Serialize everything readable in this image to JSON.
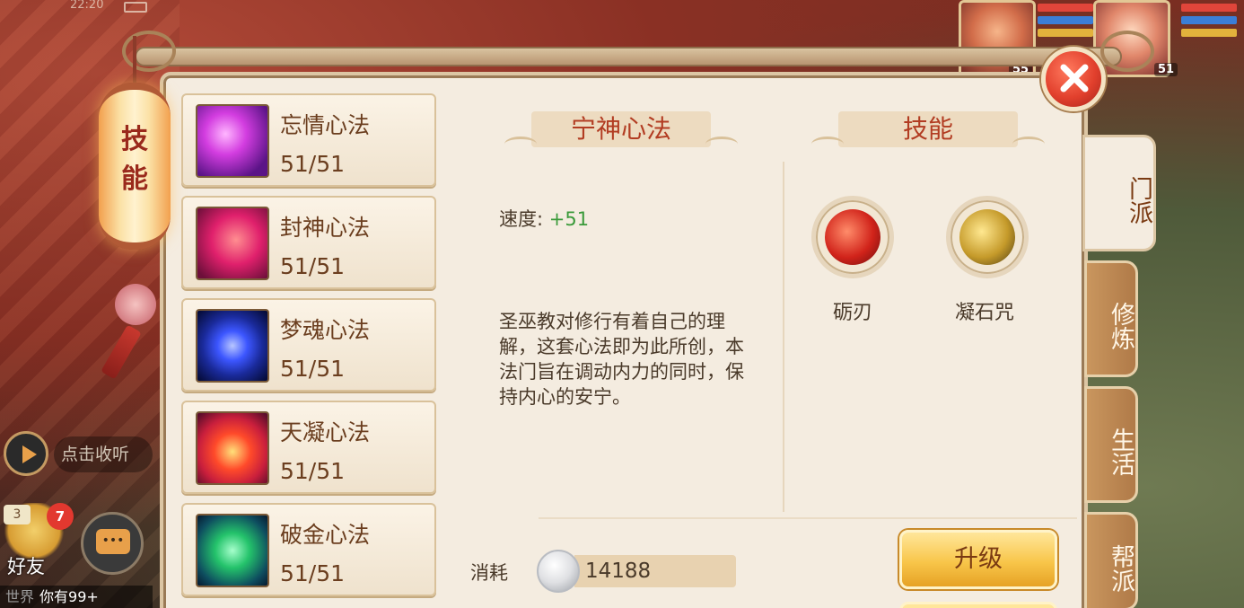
{
  "status": {
    "time": "22:20"
  },
  "party": [
    {
      "level": "55"
    },
    {
      "level": "51"
    }
  ],
  "chat": {
    "play_hint": "点击收听",
    "friend_label": "好友",
    "friend_badge": "7",
    "friend_count": "3",
    "channel": "世界",
    "message": "你有99+"
  },
  "panel": {
    "lantern_label": "技能",
    "skills": [
      {
        "name": "忘情心法",
        "level": "51/51",
        "icon": "pink-swirl-icon"
      },
      {
        "name": "封神心法",
        "level": "51/51",
        "icon": "heart-swirl-icon"
      },
      {
        "name": "梦魂心法",
        "level": "51/51",
        "icon": "blue-orb-icon"
      },
      {
        "name": "天凝心法",
        "level": "51/51",
        "icon": "red-drop-icon"
      },
      {
        "name": "破金心法",
        "level": "51/51",
        "icon": "green-vortex-icon"
      }
    ],
    "detail": {
      "title": "宁神心法",
      "attr_label": "速度:",
      "attr_value": "+51",
      "description": "圣巫教对修行有着自己的理解，这套心法即为此所创，本法门旨在调动内力的同时，保持内心的安宁。"
    },
    "skills_section": {
      "title": "技能",
      "items": [
        {
          "label": "砺刃",
          "icon": "blade-scroll-icon"
        },
        {
          "label": "凝石咒",
          "icon": "stone-curse-icon"
        }
      ]
    },
    "cost": {
      "label": "消耗",
      "value": "14188",
      "currency_icon": "silver-coin-icon"
    },
    "upgrade_label": "升级",
    "tabs": [
      {
        "label": "门派",
        "active": true
      },
      {
        "label": "修炼",
        "active": false
      },
      {
        "label": "生活",
        "active": false
      },
      {
        "label": "帮派",
        "active": false
      }
    ]
  },
  "colors": {
    "panel_bg": "#f4ece0",
    "title_red": "#b23c22",
    "value_green": "#3a9a3a",
    "button_gold": "#f8c64a"
  }
}
